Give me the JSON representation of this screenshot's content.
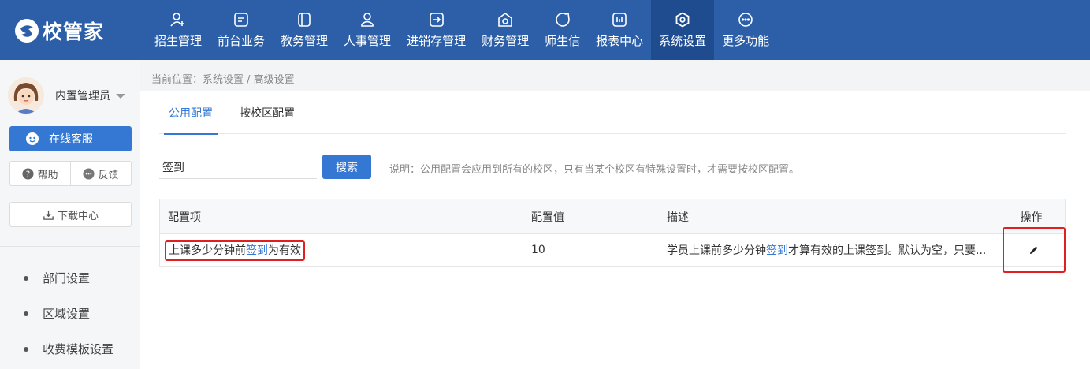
{
  "app": {
    "logo_text": "校管家"
  },
  "nav": {
    "items": [
      {
        "label": "招生管理",
        "icon": "user-plus-icon"
      },
      {
        "label": "前台业务",
        "icon": "desk-icon"
      },
      {
        "label": "教务管理",
        "icon": "book-icon"
      },
      {
        "label": "人事管理",
        "icon": "person-icon"
      },
      {
        "label": "进销存管理",
        "icon": "inventory-icon"
      },
      {
        "label": "财务管理",
        "icon": "finance-icon"
      },
      {
        "label": "师生信",
        "icon": "chat-icon"
      },
      {
        "label": "报表中心",
        "icon": "report-icon"
      },
      {
        "label": "系统设置",
        "icon": "gear-icon"
      },
      {
        "label": "更多功能",
        "icon": "more-icon"
      }
    ],
    "active_index": 8
  },
  "sidebar": {
    "user_name": "内置管理员",
    "service_label": "在线客服",
    "help_label": "帮助",
    "feedback_label": "反馈",
    "download_label": "下载中心",
    "menu": [
      "部门设置",
      "区域设置",
      "收费模板设置"
    ]
  },
  "breadcrumb": "当前位置：系统设置 / 高级设置",
  "tabs": [
    "公用配置",
    "按校区配置"
  ],
  "search": {
    "value": "签到",
    "button_label": "搜索",
    "note": "说明：公用配置会应用到所有的校区，只有当某个校区有特殊设置时，才需要按校区配置。"
  },
  "table": {
    "headers": [
      "配置项",
      "配置值",
      "描述",
      "操作"
    ],
    "row": {
      "item_prefix": "上课多少分钟前",
      "item_highlight": "签到",
      "item_suffix": "为有效",
      "value": "10",
      "desc_prefix": "学员上课前多少分钟",
      "desc_highlight": "签到",
      "desc_suffix": "才算有效的上课签到。默认为空，只要..."
    }
  },
  "colors": {
    "topbar": "#2c5fa8",
    "accent": "#3478d4",
    "highlight_box": "#e02020"
  }
}
